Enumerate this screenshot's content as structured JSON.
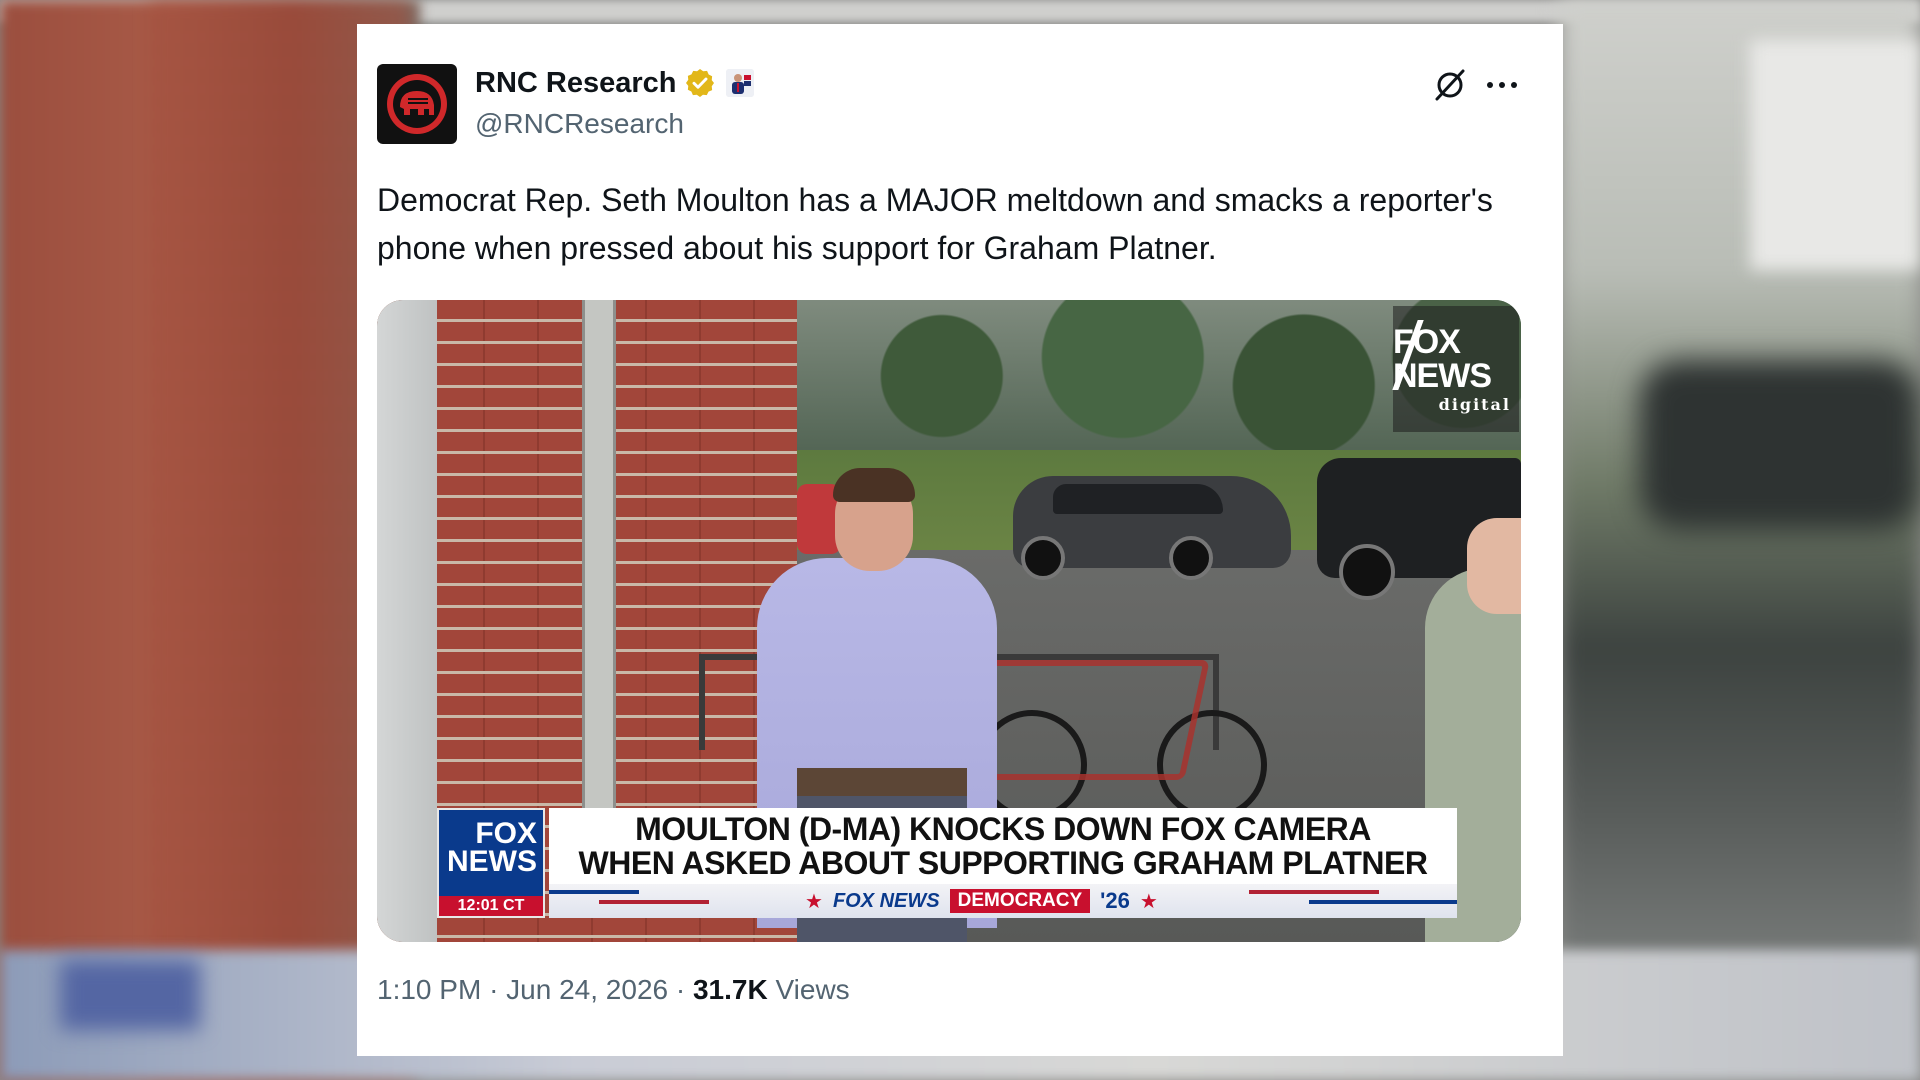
{
  "tweet": {
    "author_name": "RNC Research",
    "handle": "@RNCResearch",
    "text": "Democrat Rep. Seth Moulton has a MAJOR meltdown and smacks a reporter's phone when pressed about his support for Graham Platner.",
    "icons": {
      "verified": "verified-badge-icon",
      "affiliate": "affiliate-badge-icon",
      "grok": "grok-icon",
      "more": "more-options-icon"
    },
    "media": {
      "watermark_line1": "FOX NEWS",
      "watermark_line2": "digital",
      "chyron_logo": "FOX NEWS",
      "chyron_time": "12:01 CT",
      "chyron_headline_1": "MOULTON (D-MA) KNOCKS DOWN FOX CAMERA",
      "chyron_headline_2": "WHEN ASKED ABOUT SUPPORTING GRAHAM PLATNER",
      "bar_brand": "FOX NEWS",
      "bar_tag": "DEMOCRACY",
      "bar_year": "'26",
      "star": "★"
    },
    "time": "1:10 PM",
    "separator": "·",
    "date": "Jun 24, 2026",
    "views_count": "31.7K",
    "views_label": "Views"
  },
  "colors": {
    "text_primary": "#0f1419",
    "text_secondary": "#536471",
    "verified_gold": "#e2b719",
    "fox_blue": "#0a3a8c",
    "fox_red": "#c8102e"
  }
}
